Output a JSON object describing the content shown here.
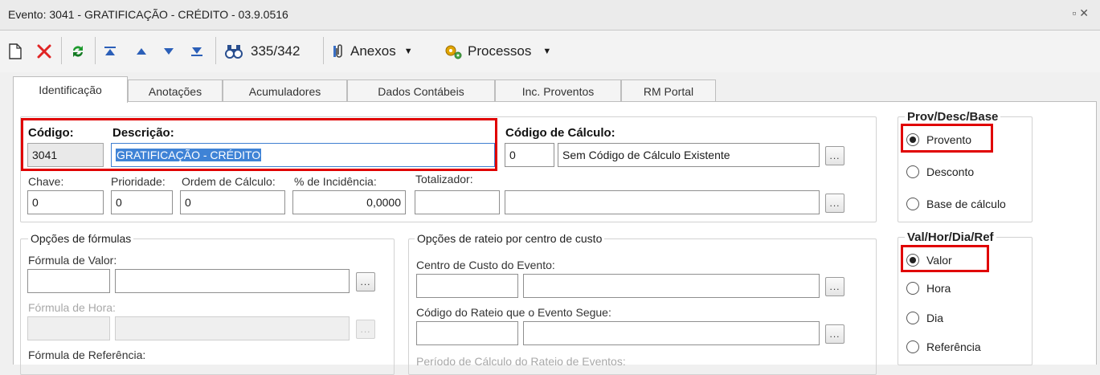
{
  "window": {
    "title": "Evento: 3041 - GRATIFICAÇÃO -  CRÉDITO - 03.9.0516",
    "restore_glyph": "▫ ✕"
  },
  "toolbar": {
    "record_counter": "335/342",
    "attachments_label": "Anexos",
    "processes_label": "Processos"
  },
  "tabs": [
    "Identificação",
    "Anotações",
    "Acumuladores",
    "Dados Contábeis",
    "Inc. Proventos",
    "RM Portal"
  ],
  "ident": {
    "codigo_label": "Código:",
    "codigo_value": "3041",
    "descricao_label": "Descrição:",
    "descricao_value": "GRATIFICAÇÃO - CRÉDITO",
    "codigo_calculo_label": "Código de Cálculo:",
    "codigo_calculo_value": "0",
    "codigo_calculo_desc": "Sem Código de Cálculo Existente",
    "chave_label": "Chave:",
    "chave_value": "0",
    "prioridade_label": "Prioridade:",
    "prioridade_value": "0",
    "ordem_label": "Ordem de Cálculo:",
    "ordem_value": "0",
    "incidencia_label": "% de Incidência:",
    "incidencia_value": "0,0000",
    "totalizador_label": "Totalizador:"
  },
  "formulas": {
    "group_label": "Opções de fórmulas",
    "valor_label": "Fórmula de Valor:",
    "hora_label": "Fórmula de Hora:",
    "referencia_label": "Fórmula de Referência:"
  },
  "rateio": {
    "group_label": "Opções de rateio por centro de custo",
    "centro_label": "Centro de Custo do Evento:",
    "codigo_label": "Código do Rateio que o Evento Segue:",
    "periodo_label": "Período de Cálculo do Rateio de Eventos:"
  },
  "prov_desc_base": {
    "group_label": "Prov/Desc/Base",
    "options": [
      "Provento",
      "Desconto",
      "Base de cálculo"
    ],
    "selected": "Provento"
  },
  "val_hor_dia_ref": {
    "group_label": "Val/Hor/Dia/Ref",
    "options": [
      "Valor",
      "Hora",
      "Dia",
      "Referência"
    ],
    "selected": "Valor"
  },
  "ellipsis": "..."
}
